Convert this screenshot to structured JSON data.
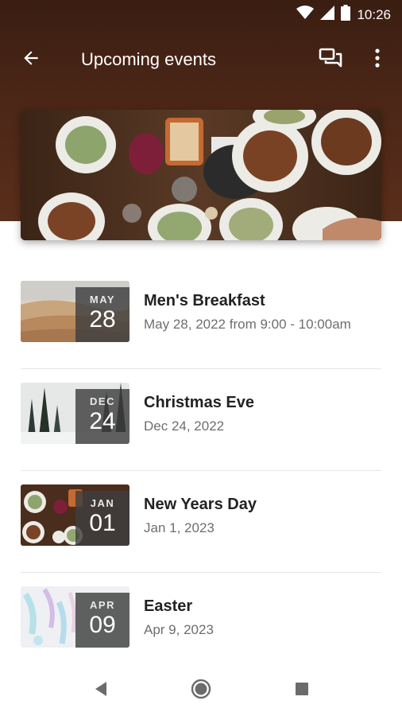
{
  "status_bar": {
    "time": "10:26",
    "icons": [
      "wifi-icon",
      "signal-icon",
      "battery-icon"
    ]
  },
  "toolbar": {
    "title": "Upcoming events",
    "back_icon": "arrow-back-icon",
    "chat_icon": "chat-icon",
    "more_icon": "more-vert-icon"
  },
  "events": [
    {
      "title": "Men's Breakfast",
      "subtitle": "May 28, 2022 from 9:00 - 10:00am",
      "month": "MAY",
      "day": "28"
    },
    {
      "title": "Christmas Eve",
      "subtitle": "Dec 24, 2022",
      "month": "DEC",
      "day": "24"
    },
    {
      "title": "New Years Day",
      "subtitle": "Jan 1, 2023",
      "month": "JAN",
      "day": "01"
    },
    {
      "title": "Easter",
      "subtitle": "Apr 9, 2023",
      "month": "APR",
      "day": "09"
    }
  ],
  "nav_bar": {
    "icons": [
      "back-triangle-icon",
      "home-circle-icon",
      "recents-square-icon"
    ]
  },
  "colors": {
    "header": "#4b2617",
    "title_text": "#222222",
    "subtitle_text": "#6e6e6e",
    "date_box": "#3e3e3e"
  }
}
